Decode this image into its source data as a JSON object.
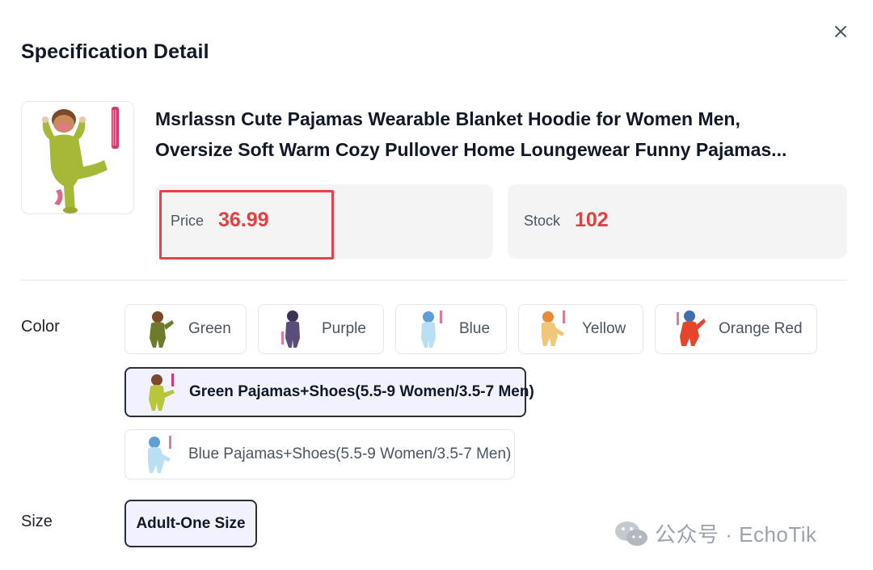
{
  "dialog": {
    "title": "Specification Detail"
  },
  "product": {
    "name_line1": "Msrlassn Cute Pajamas Wearable Blanket Hoodie for Women Men,",
    "name_line2": "Oversize Soft Warm Cozy Pullover Home Loungewear Funny Pajamas...",
    "price_label": "Price",
    "price_value": "36.99",
    "stock_label": "Stock",
    "stock_value": "102"
  },
  "color": {
    "label": "Color",
    "options": [
      {
        "label": "Green",
        "swatch": "#8a8f2e"
      },
      {
        "label": "Purple",
        "swatch": "#5a4d7a"
      },
      {
        "label": "Blue",
        "swatch": "#a9d4ee"
      },
      {
        "label": "Yellow",
        "swatch": "#e9b25a"
      },
      {
        "label": "Orange Red",
        "swatch": "#e5452b"
      },
      {
        "label": "Green Pajamas+Shoes(5.5-9 Women/3.5-7 Men)",
        "swatch": "#b7c63a",
        "selected": true
      },
      {
        "label": "Blue Pajamas+Shoes(5.5-9 Women/3.5-7 Men)",
        "swatch": "#b9dff4"
      }
    ]
  },
  "size": {
    "label": "Size",
    "selected": "Adult-One Size"
  },
  "watermark": {
    "text": "公众号 · EchoTik"
  },
  "colors": {
    "accent_red": "#e53e3e",
    "highlight_border": "#e8414c",
    "selected_bg": "#f2f1ff",
    "selected_border": "#2b2f3a"
  }
}
